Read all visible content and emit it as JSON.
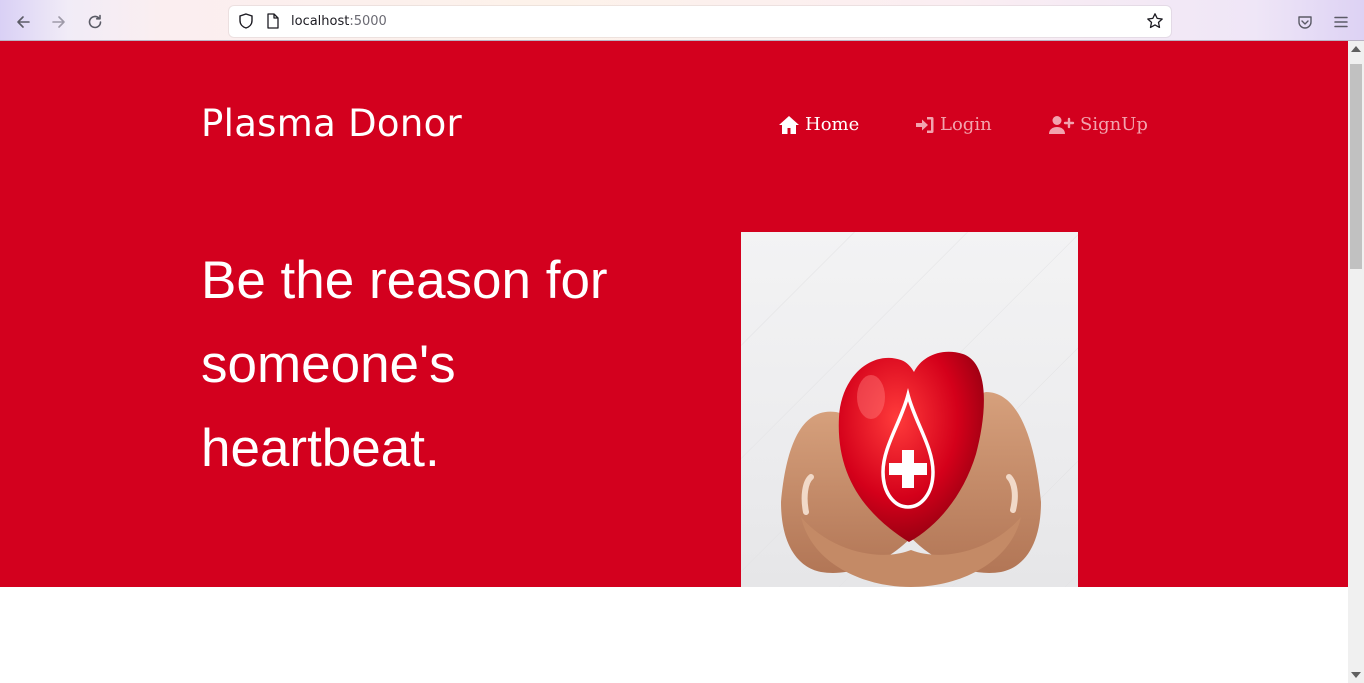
{
  "browser": {
    "url_host": "localhost",
    "url_port": ":5000"
  },
  "brand": {
    "title": "Plasma Donor"
  },
  "nav": {
    "home": "Home",
    "login": "Login",
    "signup": "SignUp"
  },
  "hero": {
    "tagline": "Be the reason for someone's heartbeat."
  },
  "colors": {
    "hero_bg": "#d3001e",
    "nav_active": "#ffffff",
    "nav_inactive": "#f2a3ae"
  }
}
